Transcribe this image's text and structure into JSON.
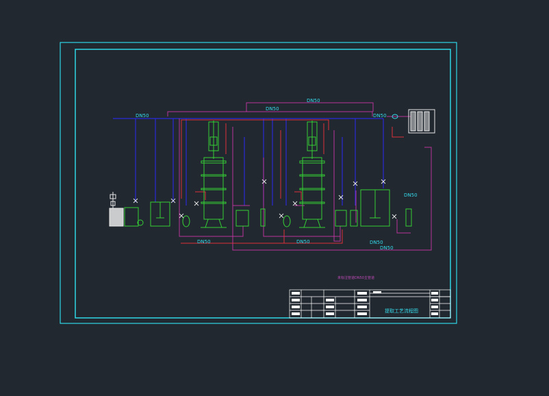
{
  "colors": {
    "background": "#212830",
    "frame": "#2fd6e6",
    "blue_pipe": "#2a2ad8",
    "red_pipe": "#e0303a",
    "magenta_pipe": "#b8359a",
    "equipment": "#35d035",
    "text_cyan": "#35d8e8",
    "title_block": "#ffffff"
  },
  "pipe_labels": {
    "dn50_top": "DN50",
    "dn50_upper": "DN50",
    "dn50_right": "DN50",
    "dn50_left": "DN50",
    "dn50_mid": "DN50",
    "dn50_bottom_left": "DN50",
    "dn50_bottom_mid": "DN50",
    "dn50_bottom_right": "DN50",
    "dn50_lowest": "DN50",
    "dn50_far_right": "DN50"
  },
  "notes": {
    "legend_note": "未标注管道DN50主管道"
  },
  "title_block": {
    "drawing_title": "提取工艺流程图"
  }
}
